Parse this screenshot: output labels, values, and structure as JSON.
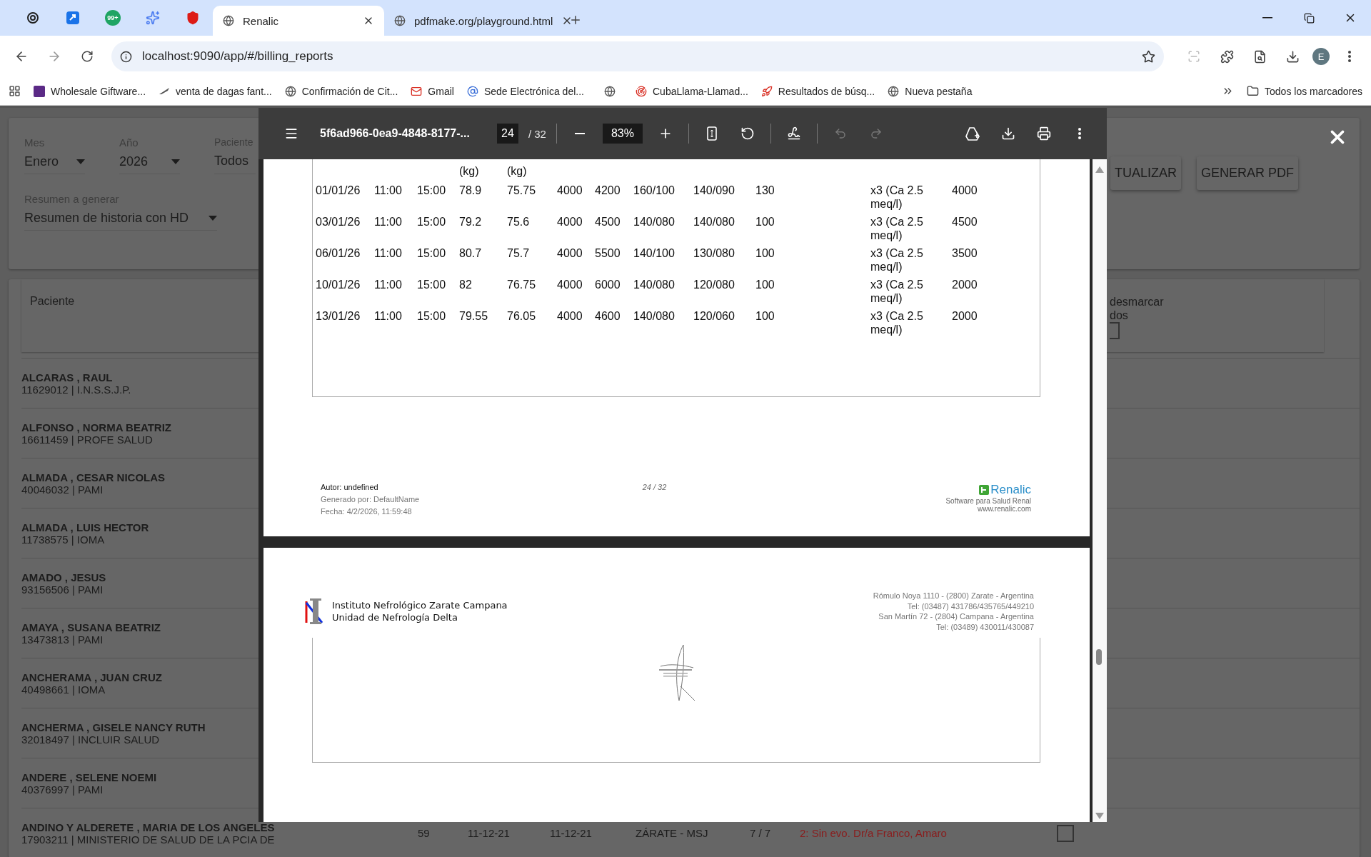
{
  "browser": {
    "pinned_tabs": [
      {
        "kind": "spiral"
      },
      {
        "kind": "blue-square"
      },
      {
        "kind": "badge",
        "badge": "99+"
      },
      {
        "kind": "sparkle"
      },
      {
        "kind": "shield"
      }
    ],
    "tabs": [
      {
        "title": "Renalic",
        "selected": true
      },
      {
        "title": "pdfmake.org/playground.html",
        "selected": false
      }
    ],
    "address": "localhost:9090/app/#/billing_reports",
    "profile_initial": "E",
    "bookmarks": [
      {
        "label": "Wholesale Giftware...",
        "kind": "purple-logo"
      },
      {
        "label": "venta de dagas fant...",
        "kind": "blade"
      },
      {
        "label": "Confirmación de Cit...",
        "kind": "globe"
      },
      {
        "label": "Gmail",
        "kind": "mail"
      },
      {
        "label": "Sede Electrónica del...",
        "kind": "at"
      },
      {
        "kind": "globe"
      },
      {
        "label": "CubaLlama-Llamad...",
        "kind": "radar"
      },
      {
        "label": "Resultados de búsq...",
        "kind": "rocket"
      },
      {
        "label": "Nueva pestaña",
        "kind": "globe"
      }
    ],
    "all_bookmarks": "Todos los marcadores"
  },
  "filters": [
    {
      "label": "Mes",
      "value": "Enero",
      "kind": "select"
    },
    {
      "label": "Año",
      "value": "2026",
      "kind": "select"
    },
    {
      "label": "Paciente",
      "value": "Todos",
      "kind": "plain"
    }
  ],
  "summary_filter": {
    "label": "Resumen a generar",
    "value": "Resumen de historia con HD"
  },
  "actions": [
    "TUALIZAR",
    "GENERAR PDF"
  ],
  "patients": {
    "header": "Paciente",
    "select_all_lines": [
      "desmarcar",
      "dos"
    ],
    "select_all_checked": false,
    "rows": [
      {
        "name": "ALCARAS , RAUL",
        "detail": "11629012 | I.N.S.S.J.P."
      },
      {
        "name": "ALFONSO , NORMA BEATRIZ",
        "detail": "16611459 | PROFE SALUD"
      },
      {
        "name": "ALMADA , CESAR NICOLAS",
        "detail": "40046032 | PAMI"
      },
      {
        "name": "ALMADA , LUIS HECTOR",
        "detail": "11738575 | IOMA"
      },
      {
        "name": "AMADO , JESUS",
        "detail": "93156506 | PAMI"
      },
      {
        "name": "AMAYA , SUSANA BEATRIZ",
        "detail": "13473813 | PAMI"
      },
      {
        "name": "ANCHERAMA , JUAN CRUZ",
        "detail": "40498661 | IOMA"
      },
      {
        "name": "ANCHERMA , GISELE NANCY RUTH",
        "detail": "32018497 | INCLUIR SALUD"
      },
      {
        "name": "ANDERE , SELENE NOEMI",
        "detail": "40376997 | PAMI"
      },
      {
        "name": "ANDINO Y ALDERETE , MARIA DE LOS ANGELES",
        "detail": "17903211 | MINISTERIO DE SALUD DE LA PCIA DE",
        "cells": [
          "59",
          "11-12-21",
          "11-12-21",
          "ZÁRATE - MSJ",
          "7 / 7"
        ],
        "note": "2: Sin evo. Dr/a Franco, Amaro",
        "checked": false
      }
    ]
  },
  "pdf_viewer": {
    "title": "5f6ad966-0ea9-4848-8177-...",
    "page": "24",
    "page_total": "/ 32",
    "zoom": "83%",
    "table": {
      "weight_unit_headers": [
        "(kg)",
        "(kg)"
      ],
      "rows": [
        [
          "01/01/26",
          "11:00",
          "15:00",
          "78.9",
          "75.75",
          "4000",
          "4200",
          "160/100",
          "140/090",
          "130",
          "x3 (Ca 2.5 meq/l)",
          "4000"
        ],
        [
          "03/01/26",
          "11:00",
          "15:00",
          "79.2",
          "75.6",
          "4000",
          "4500",
          "140/080",
          "140/080",
          "100",
          "x3 (Ca 2.5 meq/l)",
          "4500"
        ],
        [
          "06/01/26",
          "11:00",
          "15:00",
          "80.7",
          "75.7",
          "4000",
          "5500",
          "140/100",
          "130/080",
          "100",
          "x3 (Ca 2.5 meq/l)",
          "3500"
        ],
        [
          "10/01/26",
          "11:00",
          "15:00",
          "82",
          "76.75",
          "4000",
          "6000",
          "140/080",
          "120/080",
          "100",
          "x3 (Ca 2.5 meq/l)",
          "2000"
        ],
        [
          "13/01/26",
          "11:00",
          "15:00",
          "79.55",
          "76.05",
          "4000",
          "4600",
          "140/080",
          "120/060",
          "100",
          "x3 (Ca 2.5 meq/l)",
          "2000"
        ]
      ]
    },
    "footer": {
      "author": "Autor: undefined",
      "generated_by": "Generado por: DefaultName",
      "date": "Fecha: 4/2/2026, 11:59:48",
      "page": "24 / 32",
      "brand": "Renalic",
      "tagline": "Software para Salud Renal",
      "url": "www.renalic.com"
    },
    "next_page": {
      "institute": "Instituto Nefrológico Zarate Campana",
      "unit": "Unidad de Nefrología Delta",
      "address_lines": [
        "Rómulo Noya 1110 - (2800) Zarate - Argentina",
        "Tel: (03487) 431786/435765/449210",
        "San Martín 72 - (2804) Campana - Argentina",
        "Tel: (03489) 430011/430087"
      ]
    }
  }
}
